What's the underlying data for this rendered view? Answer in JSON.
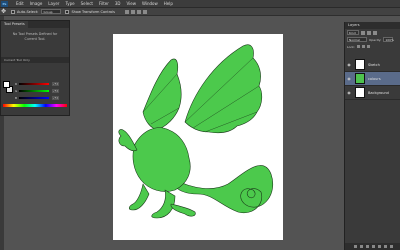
{
  "menubar": {
    "logo": "Ps",
    "items": [
      "Edit",
      "Image",
      "Layer",
      "Type",
      "Select",
      "Filter",
      "3D",
      "View",
      "Window",
      "Help"
    ]
  },
  "options": {
    "auto_select_label": "Auto-Select:",
    "auto_select_value": "Group",
    "show_transform_label": "Show Transform Controls"
  },
  "left_panel": {
    "tab": "Tool Presets",
    "message": "No Tool Presets Defined for Current Tool.",
    "subtab": "Current Tool Only",
    "color_values": [
      "255",
      "255",
      "255"
    ]
  },
  "layers": {
    "header": "Layers",
    "kind": "Kind",
    "blend_mode": "Normal",
    "opacity_label": "Opacity:",
    "opacity_value": "100%",
    "lock_label": "Lock:",
    "items": [
      {
        "name": "Sketch",
        "thumb_color": "#ffffff"
      },
      {
        "name": "colours",
        "thumb_color": "#4ec24e"
      },
      {
        "name": "Background",
        "thumb_color": "#ffffff"
      }
    ]
  },
  "colors": {
    "dragon_fill": "#4cc94c",
    "dragon_outline": "#1a3a1a",
    "selection": "#5a6b8a"
  }
}
